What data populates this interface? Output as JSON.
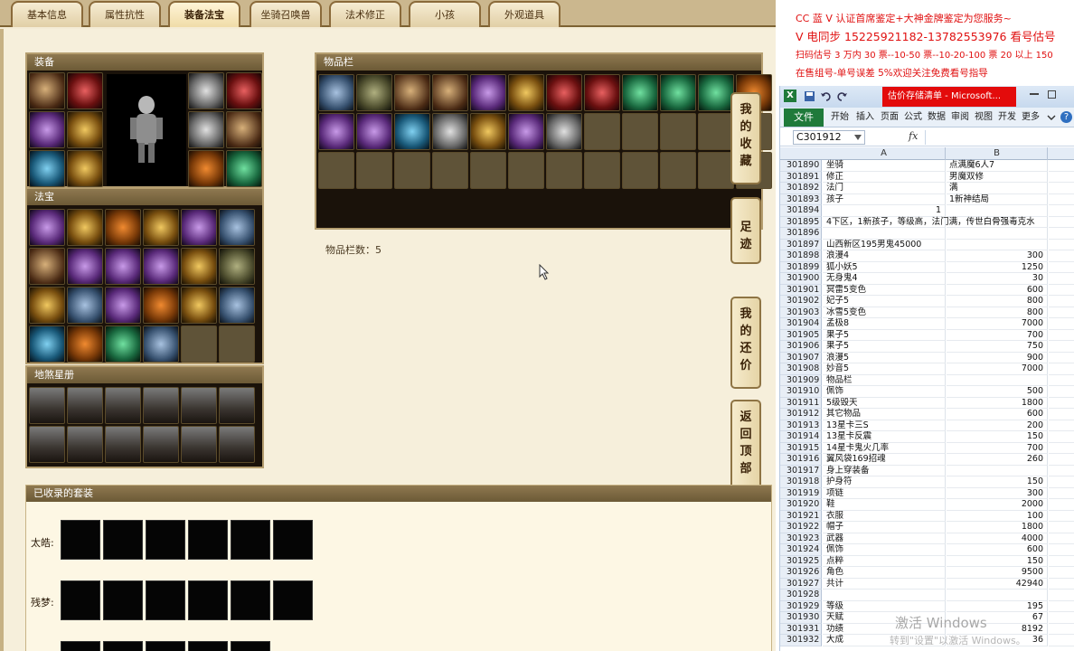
{
  "tabs": [
    "基本信息",
    "属性抗性",
    "装备法宝",
    "坐骑召唤兽",
    "法术修正",
    "小孩",
    "外观道具"
  ],
  "active_tab_index": 2,
  "panels": {
    "equipment": {
      "title": "装备"
    },
    "fabao": {
      "title": "法宝"
    },
    "dishapu": {
      "title": "地煞星册"
    },
    "inventory": {
      "title": "物品栏",
      "count_text": "物品栏数：5"
    },
    "collected": {
      "title": "已收录的套装"
    }
  },
  "side_buttons": [
    {
      "label": "我的收藏",
      "chars": [
        "我",
        "的",
        "收",
        "藏"
      ]
    },
    {
      "label": "足迹",
      "chars": [
        "足",
        "迹"
      ]
    },
    {
      "label": "我的还价",
      "chars": [
        "我",
        "的",
        "还",
        "价"
      ]
    },
    {
      "label": "返回顶部",
      "chars": [
        "返",
        "回",
        "顶",
        "部"
      ]
    }
  ],
  "sets": [
    {
      "label": "太皓:"
    },
    {
      "label": "残梦:"
    }
  ],
  "banner": {
    "line1": "CC 蓝 V 认证首席鉴定+大神金牌鉴定为您服务~",
    "line2": "V 电同步 15225921182-13782553976 看号估号",
    "line3": "扫码估号 3 万内 30 票--10-50 票--10-20-100 票 20 以上 150",
    "line4": "在售组号-单号误差 5%欢迎关注免费看号指导"
  },
  "excel": {
    "title_red": "估价存储清单 - Microsoft...",
    "ribbon_tabs": [
      "开始",
      "插入",
      "页面",
      "公式",
      "数据",
      "审阅",
      "视图",
      "开发",
      "更多"
    ],
    "file_tab": "文件",
    "name_box": "C301912",
    "col_a": "A",
    "col_b": "B",
    "rows": [
      {
        "n": "301890",
        "a": "坐骑",
        "b": "点满魔6人7"
      },
      {
        "n": "301891",
        "a": "修正",
        "b": "男魔双修"
      },
      {
        "n": "301892",
        "a": "法门",
        "b": "满"
      },
      {
        "n": "301893",
        "a": "孩子",
        "b": "1新神结局"
      },
      {
        "n": "301894",
        "a": "",
        "b": "",
        "a_num": "1"
      },
      {
        "n": "301895",
        "a": "4下区，1新孩子，等级高，法门满，传世白骨强毒克水",
        "b": ""
      },
      {
        "n": "301896",
        "a": "",
        "b": ""
      },
      {
        "n": "301897",
        "a": "山西新区195男鬼45000",
        "b": ""
      },
      {
        "n": "301898",
        "a": "浪漫4",
        "b": "300",
        "num": true
      },
      {
        "n": "301899",
        "a": "狐小妖5",
        "b": "1250",
        "num": true
      },
      {
        "n": "301900",
        "a": "无身鬼4",
        "b": "30",
        "num": true
      },
      {
        "n": "301901",
        "a": "冥雷5变色",
        "b": "600",
        "num": true
      },
      {
        "n": "301902",
        "a": "妃子5",
        "b": "800",
        "num": true
      },
      {
        "n": "301903",
        "a": "冰雪5变色",
        "b": "800",
        "num": true
      },
      {
        "n": "301904",
        "a": "孟极8",
        "b": "7000",
        "num": true
      },
      {
        "n": "301905",
        "a": "果子5",
        "b": "700",
        "num": true
      },
      {
        "n": "301906",
        "a": "果子5",
        "b": "750",
        "num": true
      },
      {
        "n": "301907",
        "a": "浪漫5",
        "b": "900",
        "num": true
      },
      {
        "n": "301908",
        "a": "妙音5",
        "b": "7000",
        "num": true
      },
      {
        "n": "301909",
        "a": "物品栏",
        "b": ""
      },
      {
        "n": "301910",
        "a": "佩饰",
        "b": "500",
        "num": true
      },
      {
        "n": "301911",
        "a": "5级毁天",
        "b": "1800",
        "num": true
      },
      {
        "n": "301912",
        "a": "其它物品",
        "b": "600",
        "num": true
      },
      {
        "n": "301913",
        "a": "13星卡三S",
        "b": "200",
        "num": true
      },
      {
        "n": "301914",
        "a": "13星卡反震",
        "b": "150",
        "num": true
      },
      {
        "n": "301915",
        "a": "14星卡鬼火几率",
        "b": "700",
        "num": true
      },
      {
        "n": "301916",
        "a": "翼风袋169招魂",
        "b": "260",
        "num": true
      },
      {
        "n": "301917",
        "a": "身上穿装备",
        "b": ""
      },
      {
        "n": "301918",
        "a": "护身符",
        "b": "150",
        "num": true
      },
      {
        "n": "301919",
        "a": "项链",
        "b": "300",
        "num": true
      },
      {
        "n": "301920",
        "a": "鞋",
        "b": "2000",
        "num": true
      },
      {
        "n": "301921",
        "a": "衣服",
        "b": "100",
        "num": true
      },
      {
        "n": "301922",
        "a": "帽子",
        "b": "1800",
        "num": true
      },
      {
        "n": "301923",
        "a": "武器",
        "b": "4000",
        "num": true
      },
      {
        "n": "301924",
        "a": "佩饰",
        "b": "600",
        "num": true
      },
      {
        "n": "301925",
        "a": "点粹",
        "b": "150",
        "num": true
      },
      {
        "n": "301926",
        "a": "角色",
        "b": "9500",
        "num": true
      },
      {
        "n": "301927",
        "a": "共计",
        "b": "42940",
        "num": true
      },
      {
        "n": "301928",
        "a": "",
        "b": ""
      },
      {
        "n": "301929",
        "a": "等级",
        "b": "195",
        "num": true
      },
      {
        "n": "301930",
        "a": "天赋",
        "b": "67",
        "num": true
      },
      {
        "n": "301931",
        "a": "功绩",
        "b": "8192",
        "num": true
      },
      {
        "n": "301932",
        "a": "大成",
        "b": "36",
        "num": true
      }
    ]
  },
  "watermark": {
    "line1": "激活 Windows",
    "line2": "转到\"设置\"以激活 Windows。"
  },
  "colors": {
    "banner_text": "#e01010",
    "excel_file_tab": "#1f7a3a",
    "title_red": "#e30b0b"
  }
}
